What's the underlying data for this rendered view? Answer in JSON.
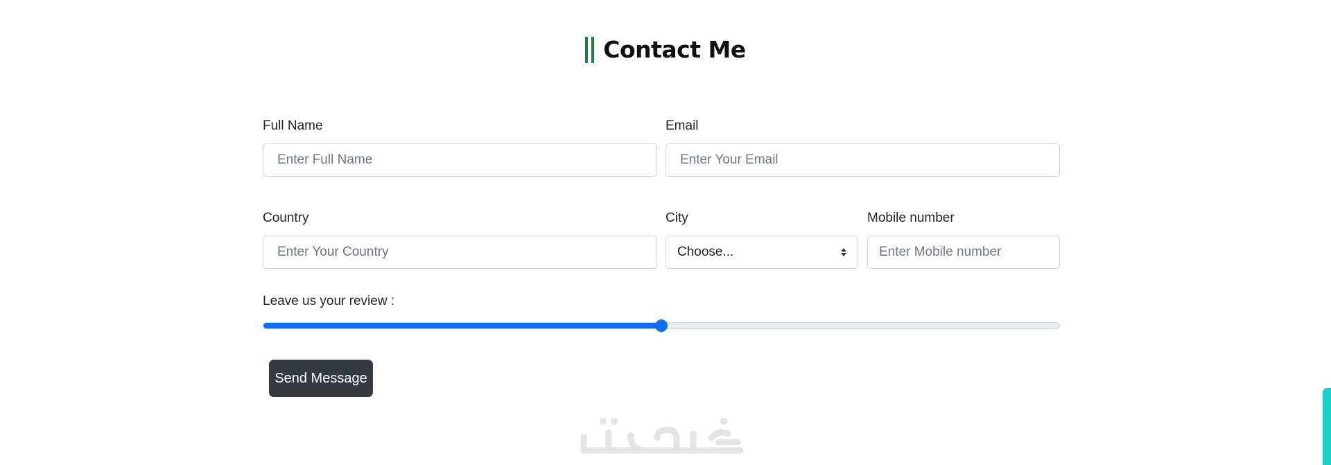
{
  "header": {
    "title": "Contact Me",
    "accent_color": "#1e7e45"
  },
  "form": {
    "full_name": {
      "label": "Full Name",
      "placeholder": "Enter Full Name"
    },
    "email": {
      "label": "Email",
      "placeholder": "Enter Your Email"
    },
    "country": {
      "label": "Country",
      "placeholder": "Enter Your Country"
    },
    "city": {
      "label": "City",
      "selected": "Choose..."
    },
    "mobile": {
      "label": "Mobile number",
      "placeholder": "Enter Mobile number"
    },
    "review": {
      "label": "Leave us your review :",
      "value_fraction": 0.5,
      "color": "#0d6efd"
    },
    "submit_label": "Send Message",
    "submit_color": "#343a40"
  },
  "watermark": {
    "text": "خمسات",
    "color": "#e4e4e4"
  },
  "scroll_indicator_color": "#17d1c6"
}
